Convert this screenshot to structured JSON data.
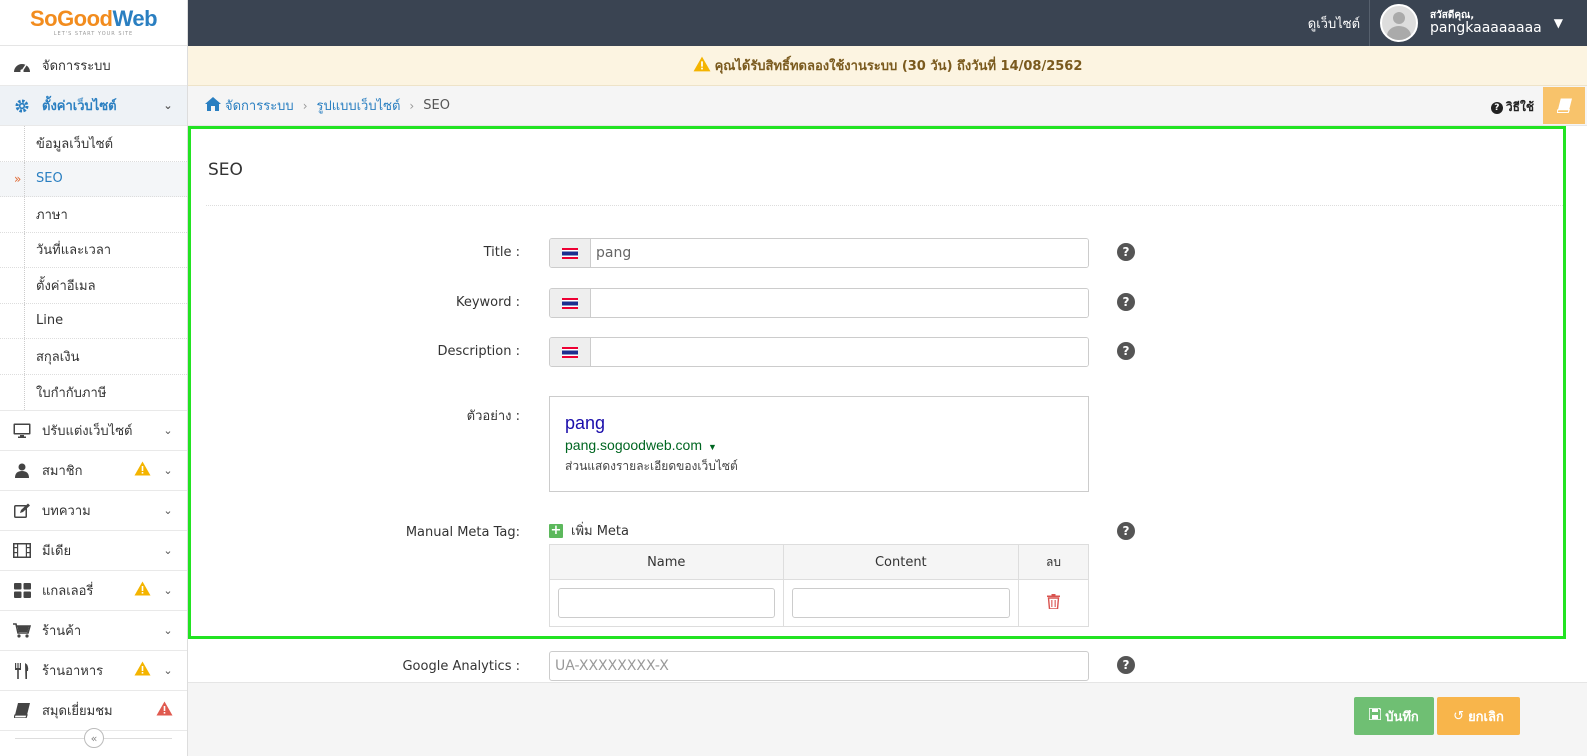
{
  "logo": {
    "part1": "SoGood",
    "part2": "Web",
    "tagline": "LET'S START YOUR SITE"
  },
  "topbar": {
    "view_site": "ดูเว็บไซต์",
    "greeting": "สวัสดีคุณ,",
    "username": "pangkaaaaaaaa"
  },
  "trial_notice": "คุณได้รับสิทธิ์ทดลองใช้งานระบบ (30 วัน) ถึงวันที่ 14/08/2562",
  "breadcrumb": {
    "items": [
      "จัดการระบบ",
      "รูปแบบเว็บไซต์"
    ],
    "current": "SEO",
    "help": "วิธีใช้"
  },
  "sidebar": {
    "items": [
      {
        "label": "จัดการระบบ",
        "icon": "dashboard-icon"
      },
      {
        "label": "ตั้งค่าเว็บไซต์",
        "icon": "gear-icon"
      },
      {
        "label": "ปรับแต่งเว็บไซต์",
        "icon": "monitor-icon"
      },
      {
        "label": "สมาชิก",
        "icon": "user-icon"
      },
      {
        "label": "บทความ",
        "icon": "edit-icon"
      },
      {
        "label": "มีเดีย",
        "icon": "film-icon"
      },
      {
        "label": "แกลเลอรี่",
        "icon": "grid-icon"
      },
      {
        "label": "ร้านค้า",
        "icon": "cart-icon"
      },
      {
        "label": "ร้านอาหาร",
        "icon": "utensils-icon"
      },
      {
        "label": "สมุดเยี่ยมชม",
        "icon": "book-icon"
      }
    ],
    "subitems": [
      "ข้อมูลเว็บไซต์",
      "SEO",
      "ภาษา",
      "วันที่และเวลา",
      "ตั้งค่าอีเมล",
      "Line",
      "สกุลเงิน",
      "ใบกำกับภาษี"
    ]
  },
  "page": {
    "title": "SEO",
    "title_label": "Title :",
    "title_value": "pang",
    "keyword_label": "Keyword :",
    "keyword_value": "",
    "description_label": "Description :",
    "description_value": "",
    "preview_label": "ตัวอย่าง :",
    "preview": {
      "title": "pang",
      "url": "pang.sogoodweb.com",
      "description": "ส่วนแสดงรายละเอียดของเว็บไซต์"
    },
    "meta_label": "Manual Meta Tag:",
    "add_meta": "เพิ่ม Meta",
    "meta_columns": [
      "Name",
      "Content",
      "ลบ"
    ],
    "ga_label": "Google Analytics :",
    "ga_placeholder": "UA-XXXXXXXX-X"
  },
  "footer": {
    "save": "บันทึก",
    "cancel": "ยกเลิก"
  },
  "colors": {
    "topbar": "#3a4452",
    "accent": "#2a7fc1",
    "save": "#6fbf73",
    "cancel": "#f8b54b",
    "highlight": "#22e322"
  }
}
